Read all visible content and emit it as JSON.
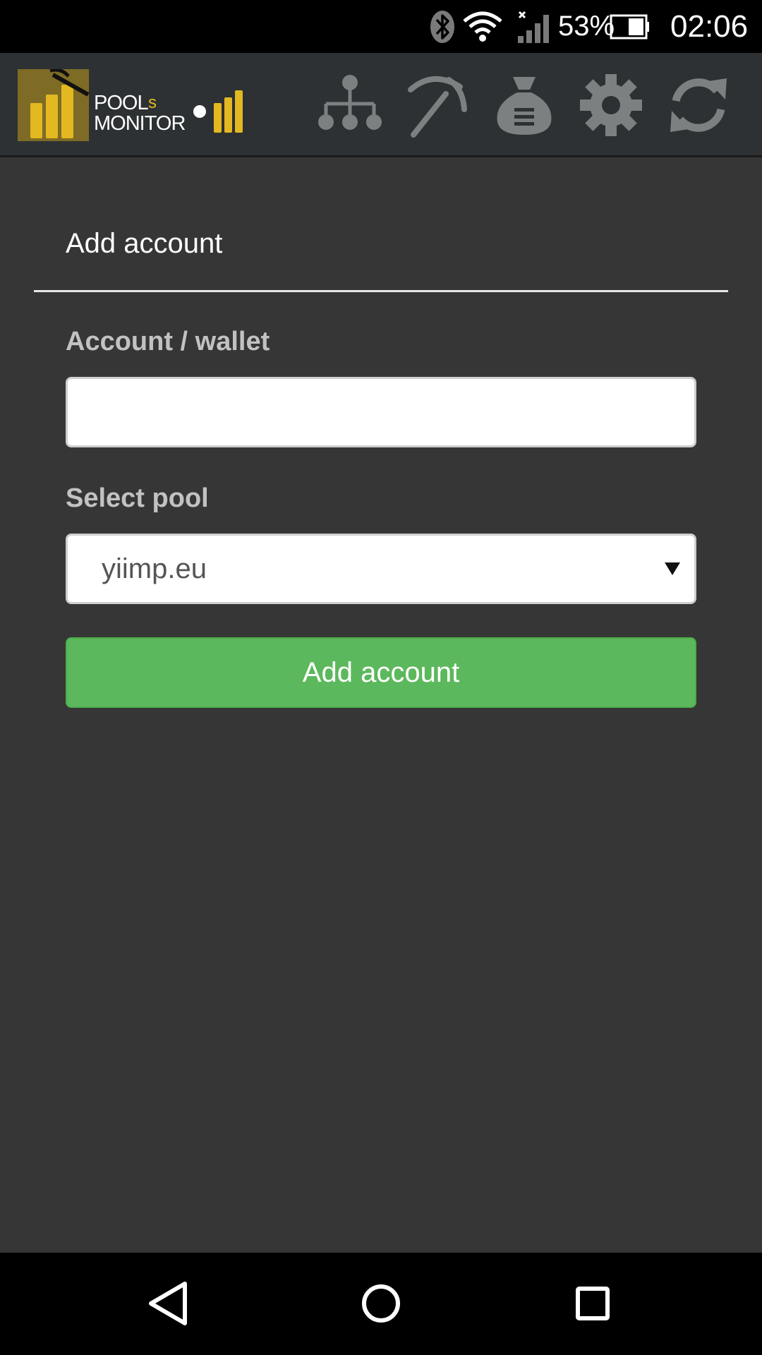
{
  "status_bar": {
    "battery_percent": "53%",
    "time": "02:06",
    "icons": [
      "bluetooth-icon",
      "wifi-icon",
      "signal-icon",
      "battery-icon"
    ]
  },
  "header": {
    "logo_text_line1": "POOLs",
    "logo_text_line2": "MONITOR",
    "nav_icons": [
      "hierarchy-icon",
      "pickaxe-icon",
      "money-bag-icon",
      "gear-icon",
      "refresh-icon"
    ],
    "accent_color": "#e3b820",
    "icon_color": "#7d8081"
  },
  "form": {
    "title": "Add account",
    "wallet_label": "Account / wallet",
    "wallet_value": "",
    "pool_label": "Select pool",
    "pool_selected": "yiimp.eu",
    "submit_label": "Add account",
    "submit_color": "#5cb85c"
  },
  "system_nav": {
    "icons": [
      "back-icon",
      "home-icon",
      "recents-icon"
    ]
  }
}
